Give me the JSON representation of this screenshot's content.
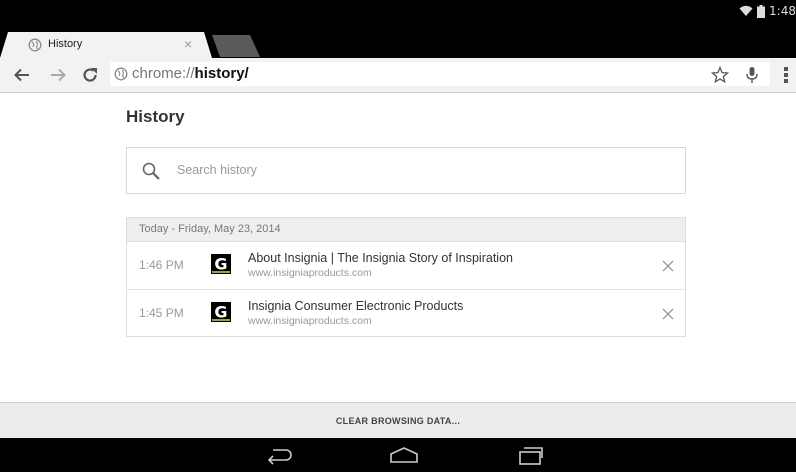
{
  "status": {
    "time": "1:48"
  },
  "tab": {
    "title": "History",
    "close": "×"
  },
  "toolbar": {
    "url_prefix": "chrome://",
    "url_path": "history/"
  },
  "page": {
    "title": "History"
  },
  "search": {
    "placeholder": "Search history",
    "value": ""
  },
  "history": {
    "date_header": "Today - Friday, May 23, 2014",
    "entries": [
      {
        "time": "1:46 PM",
        "title": "About Insignia | The Insignia Story of Inspiration",
        "domain": "www.insigniaproducts.com",
        "favicon": "G"
      },
      {
        "time": "1:45 PM",
        "title": "Insignia Consumer Electronic Products",
        "domain": "www.insigniaproducts.com",
        "favicon": "G"
      }
    ]
  },
  "bottom": {
    "clear_label": "CLEAR BROWSING DATA..."
  },
  "colors": {
    "favicon_bg": "#000000",
    "favicon_fg": "#7fb23a"
  }
}
